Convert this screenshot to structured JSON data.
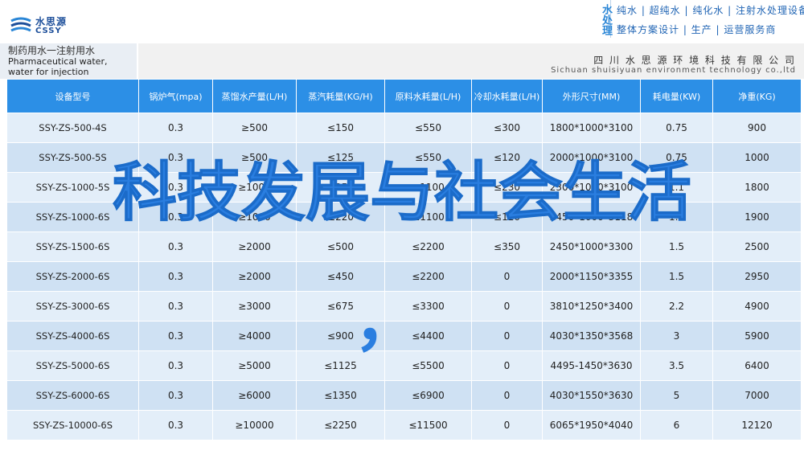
{
  "logo": {
    "cn": "水思源",
    "en": "CSSY",
    "icon": "water-drop-logo"
  },
  "brand": {
    "vertical": "水处理",
    "line1": "纯水 | 超纯水 | 纯化水 | 注射水处理设备",
    "line2": "整体方案设计 | 生产 | 运营服务商"
  },
  "title": {
    "cn": "制药用水一注射用水",
    "en": "Pharmaceutical water, water for injection"
  },
  "company": {
    "cn": "四 川 水 思 源 环 境 科 技 有 限 公 司",
    "en": "Sichuan shuisiyuan environment technology co.,ltd"
  },
  "headers": [
    "设备型号",
    "锅炉气(mpa)",
    "蒸馏水产量(L/H)",
    "蒸汽耗量(KG/H)",
    "原料水耗量(L/H)",
    "冷却水耗量(L/H)",
    "外形尺寸(MM)",
    "耗电量(KW)",
    "净重(KG)"
  ],
  "rows": [
    [
      "SSY-ZS-500-4S",
      "0.3",
      "≥500",
      "≤150",
      "≤550",
      "≤300",
      "1800*1000*3100",
      "0.75",
      "900"
    ],
    [
      "SSY-ZS-500-5S",
      "0.3",
      "≥500",
      "≤125",
      "≤550",
      "≤120",
      "2000*1000*3100",
      "0.75",
      "1000"
    ],
    [
      "SSY-ZS-1000-5S",
      "0.3",
      "≥1000",
      "≤250",
      "≤1100",
      "≤230",
      "2300*1000*3100",
      "1.1",
      "1800"
    ],
    [
      "SSY-ZS-1000-6S",
      "0.3",
      "≥1000",
      "≤220",
      "≤1100",
      "≤120",
      "2450*1000*3118",
      "1.1",
      "1900"
    ],
    [
      "SSY-ZS-1500-6S",
      "0.3",
      "≥2000",
      "≤500",
      "≤2200",
      "≤350",
      "2450*1000*3300",
      "1.5",
      "2500"
    ],
    [
      "SSY-ZS-2000-6S",
      "0.3",
      "≥2000",
      "≤450",
      "≤2200",
      "0",
      "2000*1150*3355",
      "1.5",
      "2950"
    ],
    [
      "SSY-ZS-3000-6S",
      "0.3",
      "≥3000",
      "≤675",
      "≤3300",
      "0",
      "3810*1250*3400",
      "2.2",
      "4900"
    ],
    [
      "SSY-ZS-4000-6S",
      "0.3",
      "≥4000",
      "≤900",
      "≤4400",
      "0",
      "4030*1350*3568",
      "3",
      "5900"
    ],
    [
      "SSY-ZS-5000-6S",
      "0.3",
      "≥5000",
      "≤1125",
      "≤5500",
      "0",
      "4495-1450*3630",
      "3.5",
      "6400"
    ],
    [
      "SSY-ZS-6000-6S",
      "0.3",
      "≥6000",
      "≤1350",
      "≤6900",
      "0",
      "4030*1550*3630",
      "5",
      "7000"
    ],
    [
      "SSY-ZS-10000-6S",
      "0.3",
      "≥10000",
      "≤2250",
      "≤11500",
      "0",
      "6065*1950*4040",
      "6",
      "12120"
    ]
  ],
  "overlay": {
    "headline": "科技发展与社会生活",
    "comma": "，"
  },
  "colors": {
    "header_bg": "#2c8fe6",
    "row_light": "#e3eef9",
    "row_dark": "#cfe1f3",
    "overlay": "#2a7ee0"
  }
}
